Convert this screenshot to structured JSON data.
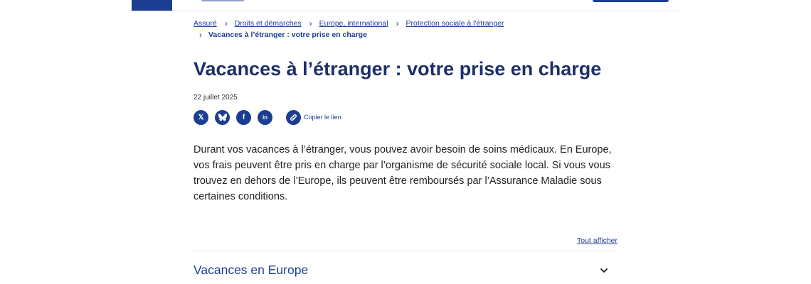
{
  "breadcrumb": {
    "items": [
      {
        "label": "Assuré"
      },
      {
        "label": "Droits et démarches"
      },
      {
        "label": "Europe, international"
      },
      {
        "label": "Protection sociale à l'étranger"
      }
    ],
    "current": "Vacances à l’étranger : votre prise en charge"
  },
  "article": {
    "title": "Vacances à l’étranger : votre prise en charge",
    "date": "22 juillet 2025",
    "intro": "Durant vos vacances à l’étranger, vous pouvez avoir besoin de soins médicaux. En Europe, vos frais peuvent être pris en charge par l’organisme de sécurité sociale local. Si vous vous trouvez en dehors de l’Europe, ils peuvent être remboursés par l’Assurance Maladie sous certaines conditions."
  },
  "share": {
    "icons": [
      "x-icon",
      "bluesky-icon",
      "facebook-icon",
      "linkedin-icon",
      "link-icon"
    ],
    "x_glyph": "𝕏",
    "facebook_glyph": "f",
    "linkedin_glyph": "in",
    "copy_label": "Copier le lien"
  },
  "accordion": {
    "show_all": "Tout afficher",
    "sections": [
      {
        "title": "Vacances en Europe"
      }
    ]
  },
  "colors": {
    "primary": "#1c3e91",
    "title": "#1c2f6b"
  }
}
